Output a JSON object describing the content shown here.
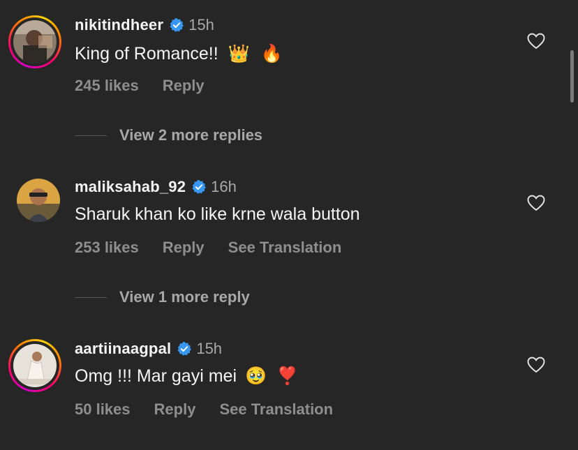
{
  "comments": [
    {
      "username": "nikitindheer",
      "time": "15h",
      "text": "King of Romance!!",
      "emojis": [
        "👑",
        "🔥"
      ],
      "likes": "245 likes",
      "reply": "Reply",
      "translation": "",
      "view_more": "View 2 more replies",
      "has_story_ring": true
    },
    {
      "username": "maliksahab_92",
      "time": "16h",
      "text": "Sharuk khan ko like krne wala button",
      "emojis": [],
      "likes": "253 likes",
      "reply": "Reply",
      "translation": "See Translation",
      "view_more": "View 1 more reply",
      "has_story_ring": false
    },
    {
      "username": "aartiinaagpal",
      "time": "15h",
      "text": "Omg !!! Mar gayi mei",
      "emojis": [
        "🥹",
        "❣️"
      ],
      "likes": "50 likes",
      "reply": "Reply",
      "translation": "See Translation",
      "view_more": "",
      "has_story_ring": true
    }
  ],
  "colors": {
    "background": "#262626",
    "verified": "#3897f0",
    "secondary_text": "#8e8e8e"
  }
}
